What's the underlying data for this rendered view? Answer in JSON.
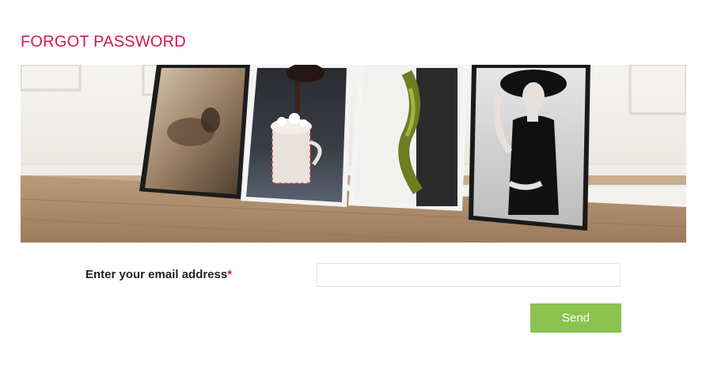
{
  "page": {
    "title": "FORGOT PASSWORD"
  },
  "banner": {
    "image": "framed-posters-leaning-on-wall-photo"
  },
  "form": {
    "email_label": "Enter your email address",
    "required_marker": "*",
    "email_value": "",
    "email_placeholder": "",
    "send_label": "Send"
  },
  "colors": {
    "accent": "#d6194f",
    "button": "#8cc24f",
    "button_text": "#ffffff"
  }
}
